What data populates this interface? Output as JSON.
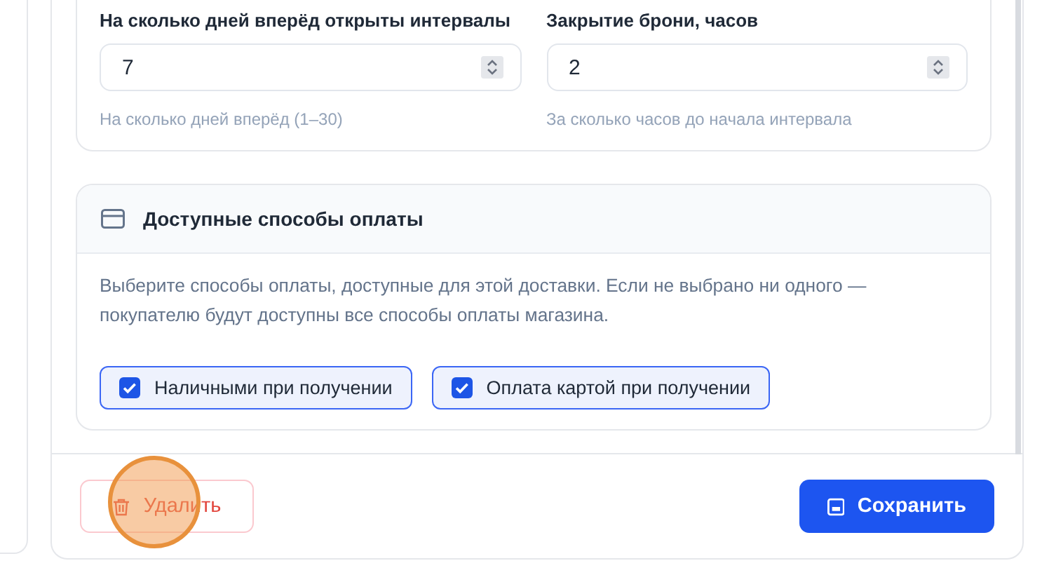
{
  "fields": [
    {
      "label": "На сколько дней вперёд открыты интервалы",
      "value": "7",
      "hint": "На сколько дней вперёд (1–30)"
    },
    {
      "label": "Закрытие брони, часов",
      "value": "2",
      "hint": "За сколько часов до начала интервала"
    }
  ],
  "payment_section": {
    "title": "Доступные способы оплаты",
    "description": "Выберите способы оплаты, доступные для этой доставки. Если не выбрано ни одного — покупателю будут доступны все способы оплаты магазина.",
    "options": [
      {
        "label": "Наличными при получении",
        "checked": true
      },
      {
        "label": "Оплата картой при получении",
        "checked": true
      }
    ]
  },
  "footer": {
    "delete_button": "Удалить",
    "save_button": "Сохранить"
  }
}
